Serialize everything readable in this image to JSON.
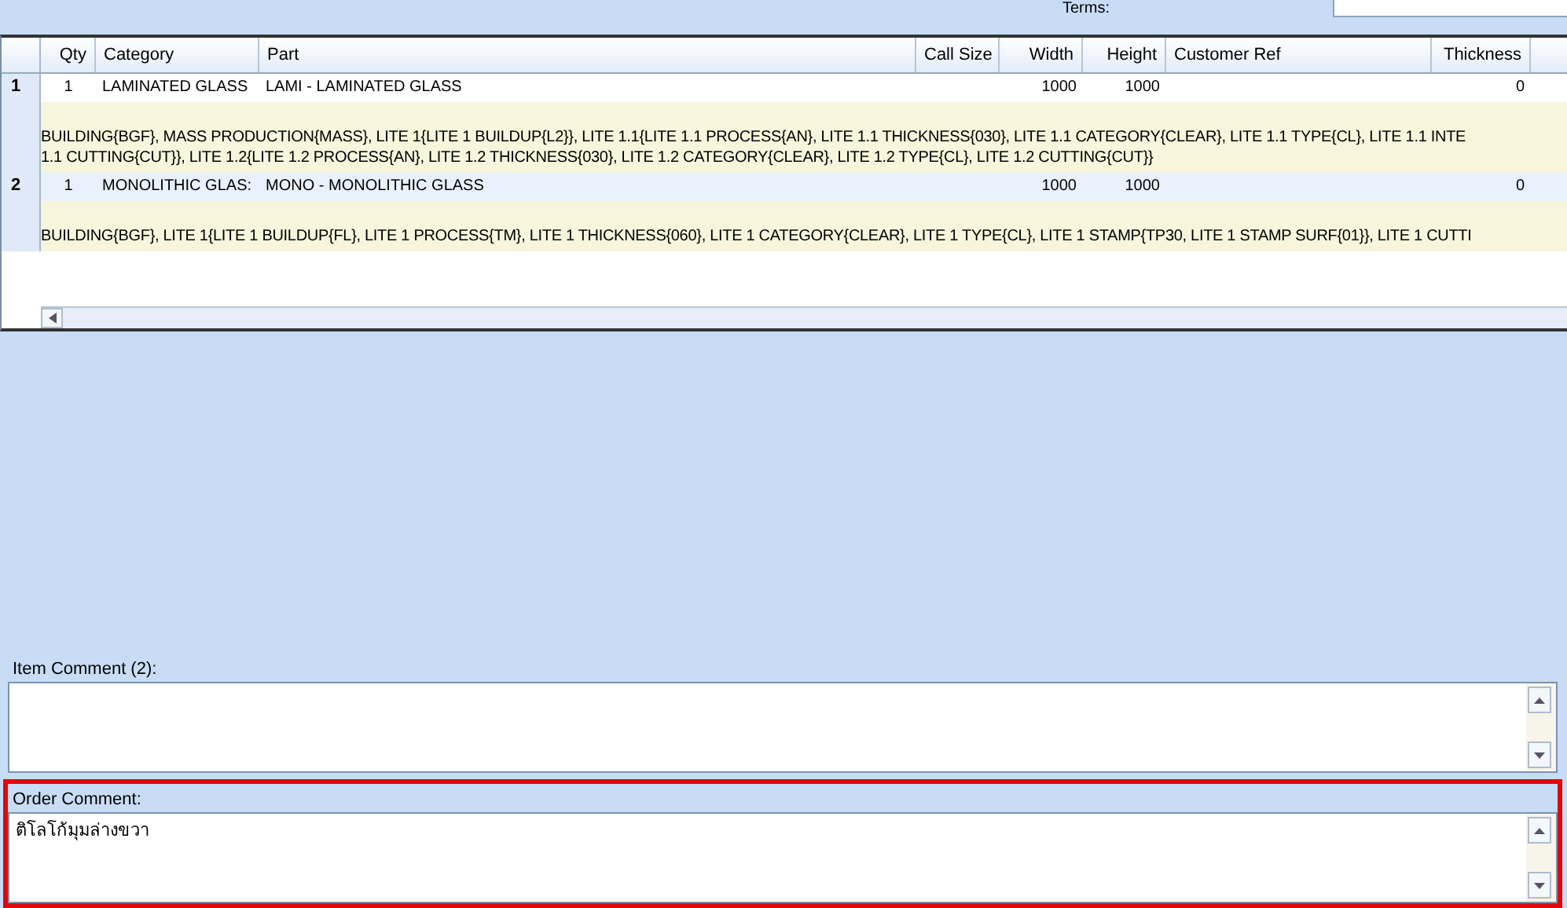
{
  "top_bar": {
    "terms_label": "Terms:"
  },
  "grid": {
    "columns": [
      "Qty",
      "Category",
      "Part",
      "Call Size",
      "Width",
      "Height",
      "Customer Ref",
      "Thickness"
    ],
    "rows": [
      {
        "number": "1",
        "selected": false,
        "cells": [
          "1",
          "LAMINATED GLASS",
          "LAMI - LAMINATED GLASS",
          "",
          "1000",
          "1000",
          "",
          "0"
        ],
        "details": [
          "BUILDING{BGF}, MASS PRODUCTION{MASS}, LITE 1{LITE 1 BUILDUP{L2}}, LITE 1.1{LITE 1.1 PROCESS{AN}, LITE 1.1 THICKNESS{030}, LITE 1.1 CATEGORY{CLEAR}, LITE 1.1 TYPE{CL}, LITE 1.1 INTE",
          "1.1 CUTTING{CUT}}, LITE 1.2{LITE 1.2 PROCESS{AN}, LITE 1.2 THICKNESS{030}, LITE 1.2 CATEGORY{CLEAR}, LITE 1.2 TYPE{CL}, LITE 1.2 CUTTING{CUT}}"
        ]
      },
      {
        "number": "2",
        "selected": true,
        "cells": [
          "1",
          "MONOLITHIC GLAS:",
          "MONO - MONOLITHIC GLASS",
          "",
          "1000",
          "1000",
          "",
          "0"
        ],
        "details": [
          "BUILDING{BGF}, LITE 1{LITE 1 BUILDUP{FL}, LITE 1 PROCESS{TM}, LITE 1 THICKNESS{060}, LITE 1 CATEGORY{CLEAR}, LITE 1 TYPE{CL}, LITE 1 STAMP{TP30, LITE 1 STAMP SURF{01}}, LITE 1 CUTTI"
        ]
      }
    ]
  },
  "comments": [
    {
      "label": "Item Comment (2):",
      "highlighted": false
    },
    {
      "label": "Order Comment:",
      "value": "ติโลโก้มุมล่างขวา",
      "highlighted": true
    }
  ]
}
